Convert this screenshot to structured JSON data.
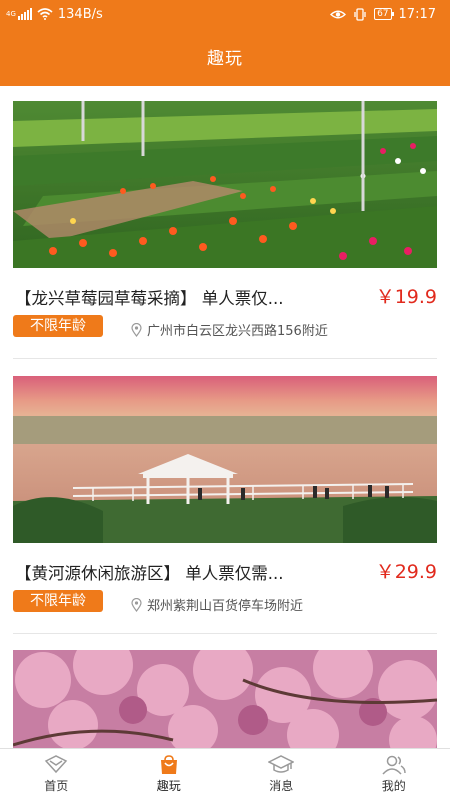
{
  "status_bar": {
    "network": "4G",
    "speed": "134B/s",
    "battery": "67",
    "time": "17:17"
  },
  "header": {
    "title": "趣玩"
  },
  "colors": {
    "accent": "#ef7a1a",
    "price": "#e12a1d"
  },
  "cards": [
    {
      "title": "【龙兴草莓园草莓采摘】 单人票仅...",
      "price": "￥19.9",
      "age_tag": "不限年龄",
      "location": "广州市白云区龙兴西路156附近",
      "image": "flower-nursery-photo"
    },
    {
      "title": "【黄河源休闲旅游区】 单人票仅需...",
      "price": "￥29.9",
      "age_tag": "不限年龄",
      "location": "郑州紫荆山百货停车场附近",
      "image": "lakeside-gazebo-photo"
    },
    {
      "image": "cherry-blossom-photo"
    }
  ],
  "tab_bar": {
    "items": [
      {
        "label": "首页",
        "icon": "home-icon"
      },
      {
        "label": "趣玩",
        "icon": "fun-bag-icon",
        "active": true
      },
      {
        "label": "消息",
        "icon": "message-icon"
      },
      {
        "label": "我的",
        "icon": "profile-icon"
      }
    ]
  }
}
